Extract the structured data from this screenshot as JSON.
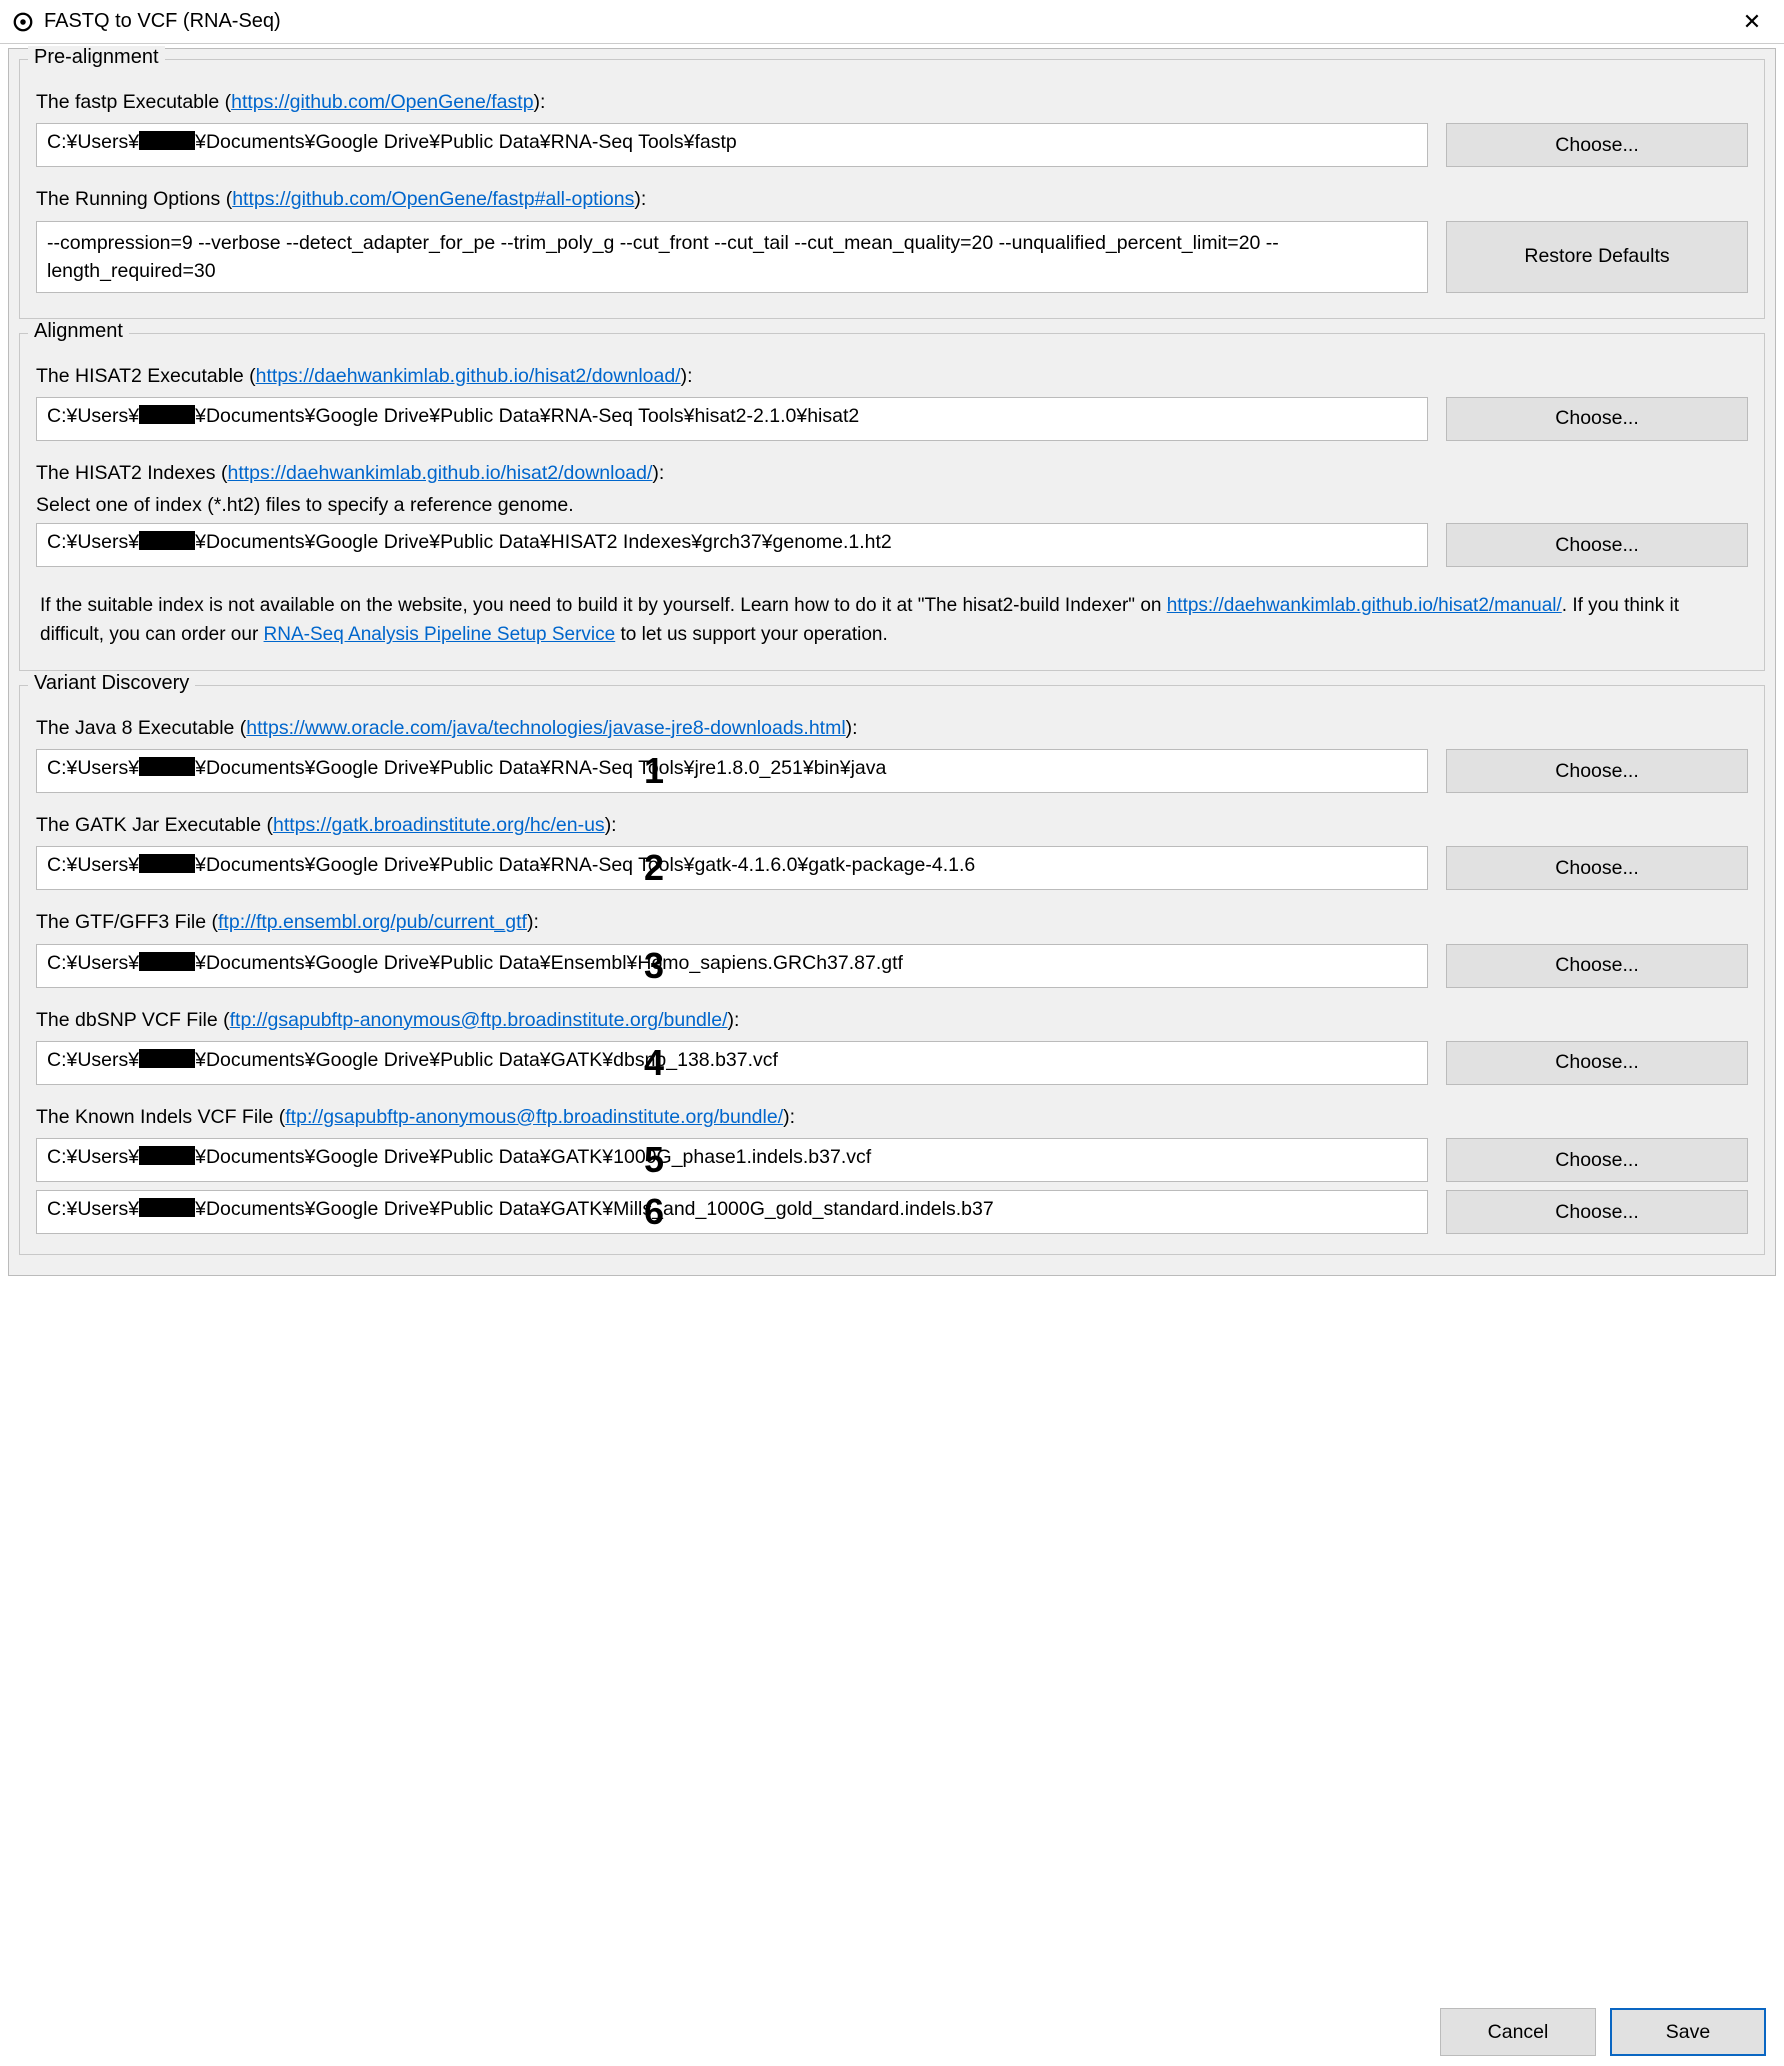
{
  "window": {
    "title": "FASTQ to VCF (RNA-Seq)",
    "close_glyph": "✕"
  },
  "redacted_user_prefix": "C:¥Users¥",
  "redacted_user_suffix": "¥Documents¥Google Drive¥",
  "groups": {
    "pre_alignment": {
      "legend": "Pre-alignment",
      "fastp_exec": {
        "label_prefix": "The fastp Executable (",
        "label_link": "https://github.com/OpenGene/fastp",
        "label_suffix": "):",
        "value_tail": "Public Data¥RNA-Seq Tools¥fastp",
        "choose": "Choose..."
      },
      "fastp_opts": {
        "label_prefix": "The Running Options (",
        "label_link": "https://github.com/OpenGene/fastp#all-options",
        "label_suffix": "):",
        "value": "--compression=9 --verbose --detect_adapter_for_pe --trim_poly_g --cut_front --cut_tail --cut_mean_quality=20 --unqualified_percent_limit=20 --length_required=30",
        "restore": "Restore Defaults"
      }
    },
    "alignment": {
      "legend": "Alignment",
      "hisat2_exec": {
        "label_prefix": "The HISAT2 Executable (",
        "label_link": "https://daehwankimlab.github.io/hisat2/download/",
        "label_suffix": "):",
        "value_tail": "Public Data¥RNA-Seq Tools¥hisat2-2.1.0¥hisat2",
        "choose": "Choose..."
      },
      "hisat2_idx": {
        "label_prefix": "The HISAT2 Indexes (",
        "label_link": "https://daehwankimlab.github.io/hisat2/download/",
        "label_suffix": "):",
        "sublabel": "Select one of index (*.ht2) files to specify a reference genome.",
        "value_tail": "Public Data¥HISAT2 Indexes¥grch37¥genome.1.ht2",
        "choose": "Choose..."
      },
      "note1": "If the suitable index is not available on the website, you need to build it by yourself. Learn how to do it at \"The hisat2-build Indexer\" on ",
      "note_link1": "https://daehwankimlab.github.io/hisat2/manual/",
      "note_mid": ". If you think it difficult, you can order our ",
      "note_link2_text": "RNA-Seq Analysis Pipeline Setup Service",
      "note_end": " to let us support your operation."
    },
    "variant": {
      "legend": "Variant Discovery",
      "java8": {
        "label_prefix": "The Java 8 Executable (",
        "label_link": "https://www.oracle.com/java/technologies/javase-jre8-downloads.html",
        "label_suffix": "):",
        "value_tail": "Public Data¥RNA-Seq Tools¥jre1.8.0_251¥bin¥java",
        "choose": "Choose...",
        "num": "1"
      },
      "gatk": {
        "label_prefix": "The GATK Jar Executable (",
        "label_link": "https://gatk.broadinstitute.org/hc/en-us",
        "label_suffix": "):",
        "value_tail": "Public Data¥RNA-Seq Tools¥gatk-4.1.6.0¥gatk-package-4.1.6",
        "choose": "Choose...",
        "num": "2"
      },
      "gtf": {
        "label_prefix": "The GTF/GFF3 File (",
        "label_link": "ftp://ftp.ensembl.org/pub/current_gtf",
        "label_suffix": "):",
        "value_tail": "Public Data¥Ensembl¥Homo_sapiens.GRCh37.87.gtf",
        "choose": "Choose...",
        "num": "3"
      },
      "dbsnp": {
        "label_prefix": "The dbSNP VCF File (",
        "label_link": "ftp://gsapubftp-anonymous@ftp.broadinstitute.org/bundle/",
        "label_suffix": "):",
        "value_tail": "Public Data¥GATK¥dbsnp_138.b37.vcf",
        "choose": "Choose...",
        "num": "4"
      },
      "indels": {
        "label_prefix": "The Known Indels VCF File (",
        "label_link": "ftp://gsapubftp-anonymous@ftp.broadinstitute.org/bundle/",
        "label_suffix": "):",
        "value_tail_a": "Public Data¥GATK¥1000G_phase1.indels.b37.vcf",
        "value_tail_b": "Public Data¥GATK¥Mills_and_1000G_gold_standard.indels.b37",
        "choose": "Choose...",
        "num_a": "5",
        "num_b": "6"
      }
    }
  },
  "footer": {
    "cancel": "Cancel",
    "save": "Save"
  }
}
